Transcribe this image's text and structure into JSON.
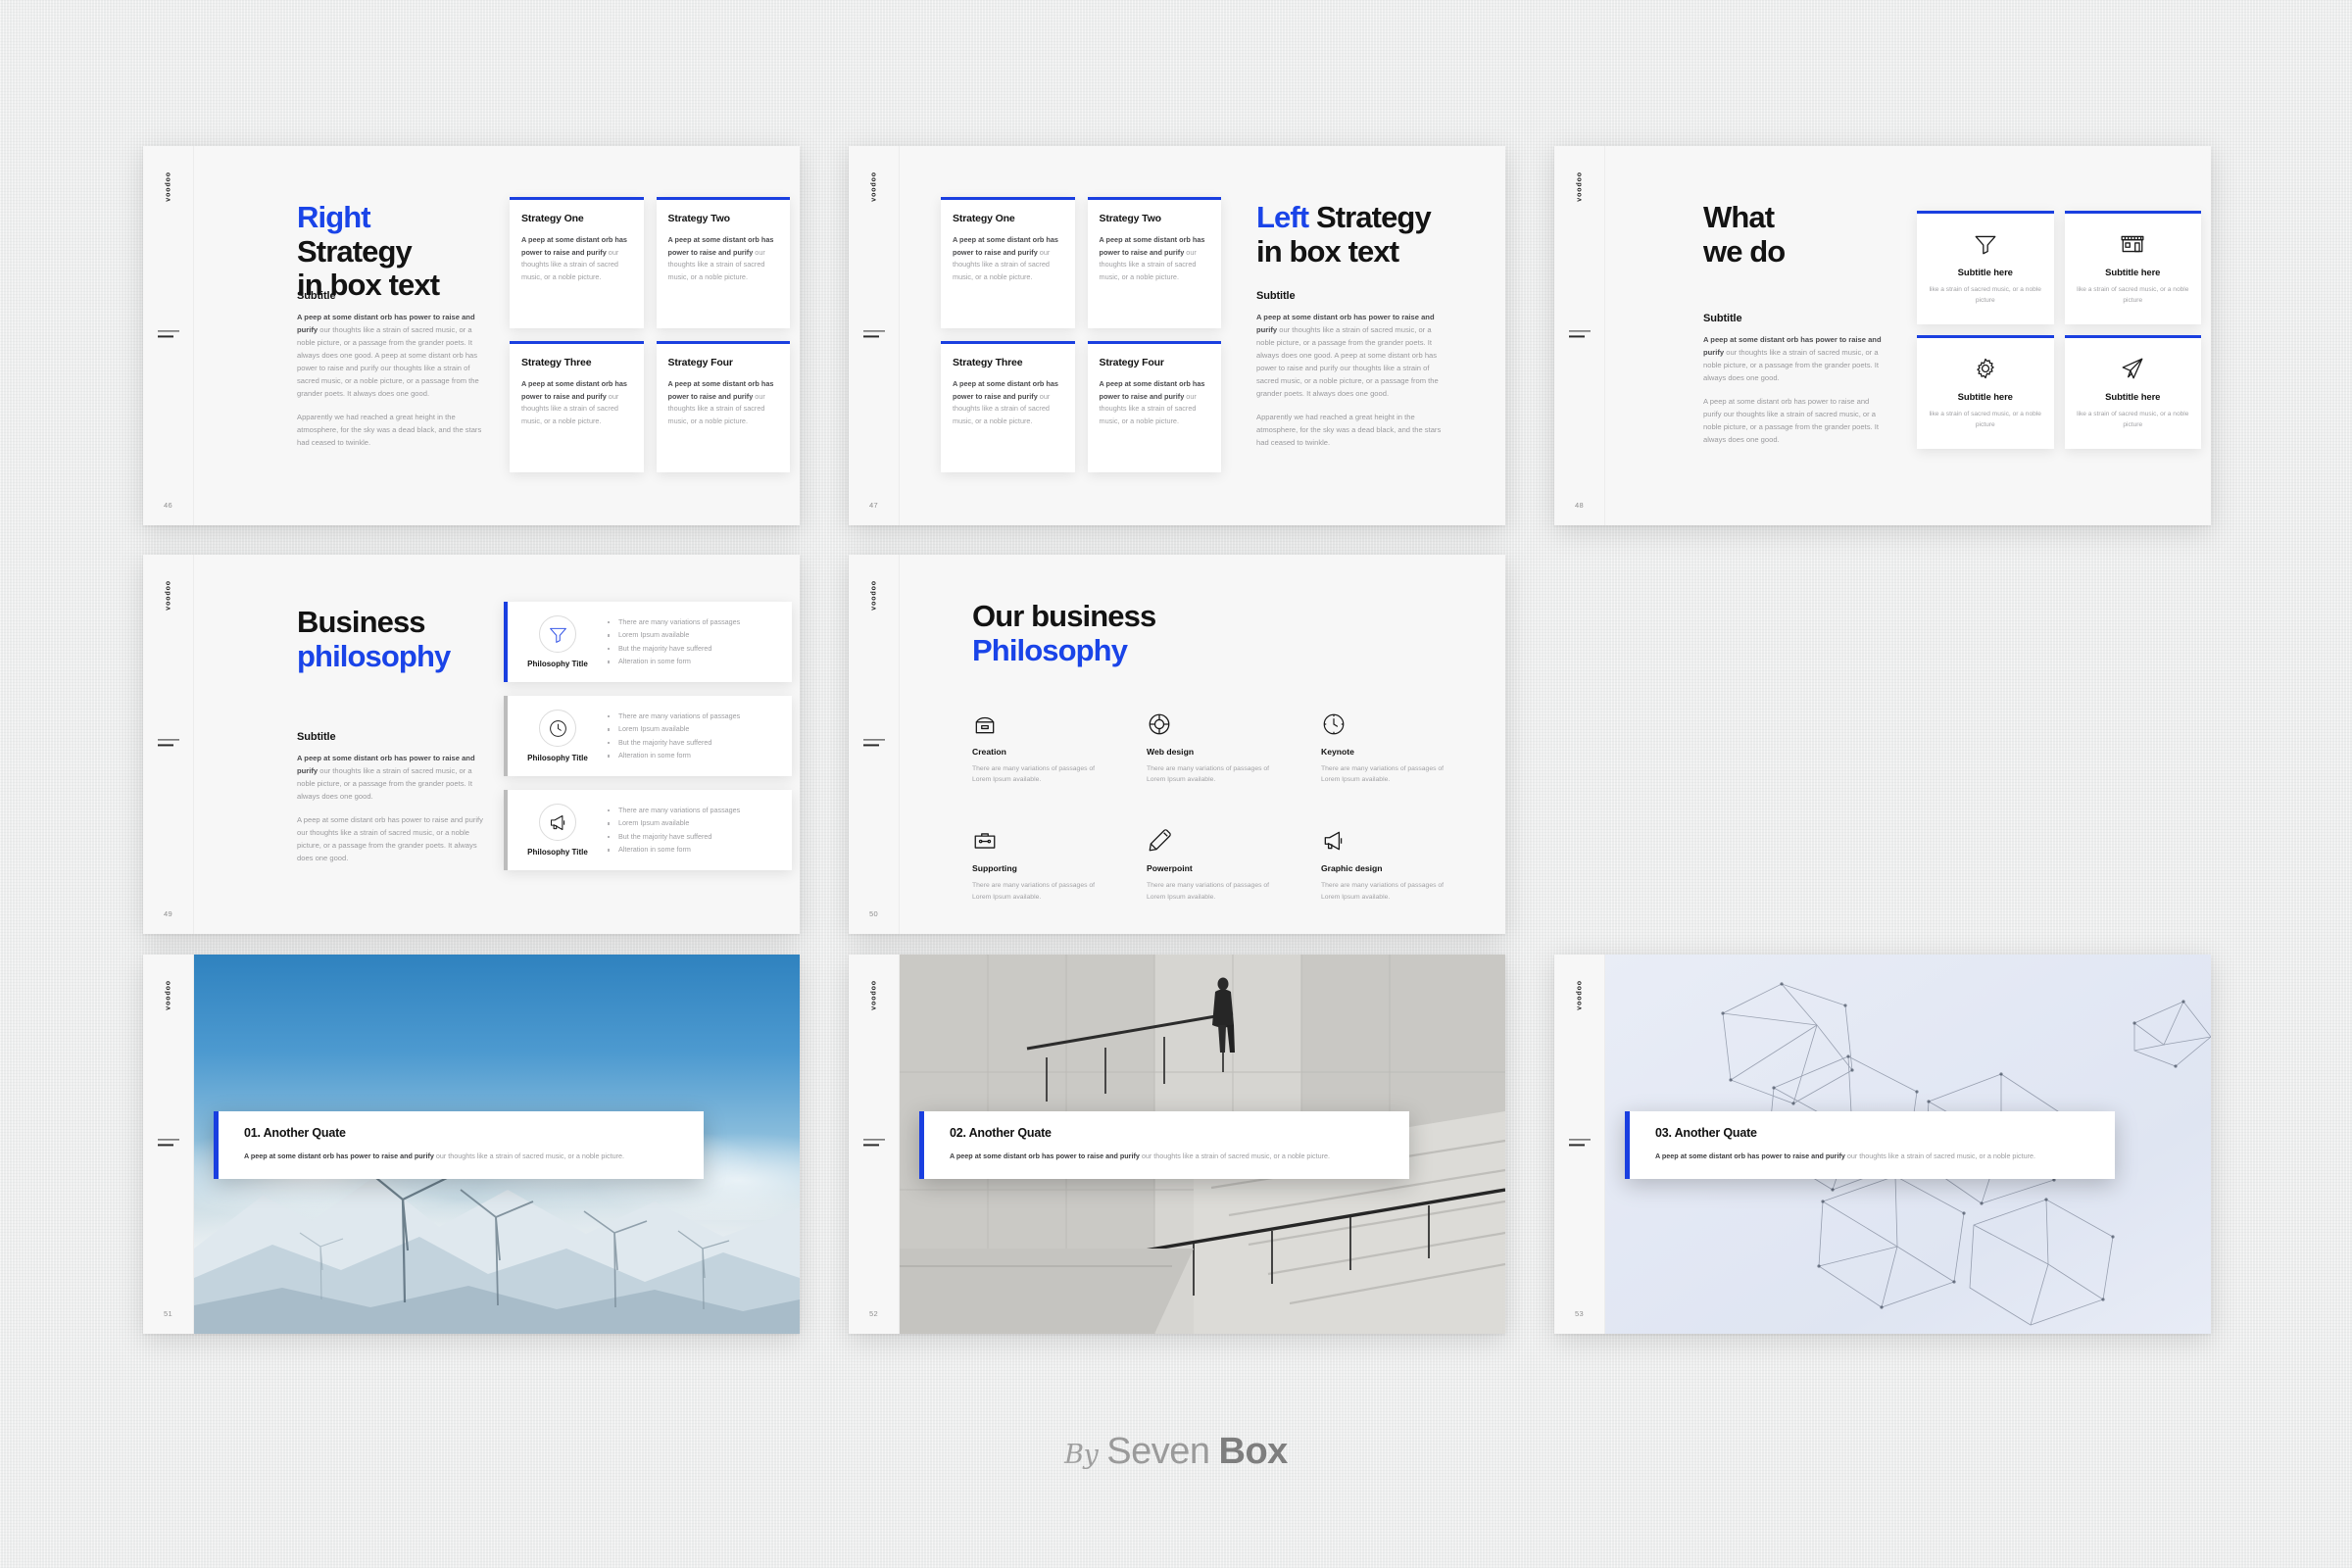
{
  "page": {
    "background_color": "#eceded",
    "accent_color": "#1a3fe0",
    "footer": {
      "by": "By",
      "brand_light": "Seven",
      "brand_bold": "Box"
    }
  },
  "shared": {
    "brand_rail_label": "voodoo",
    "subtitle_heading": "Subtitle",
    "lorem_bold": "A peep at some distant orb has power to raise and purify",
    "card_body_bold": "A peep at some distant orb has power to raise and purify",
    "card_body_rest": " our thoughts like a strain of sacred music, or a noble picture.",
    "para_long_rest": " our thoughts like a strain of sacred music, or a noble picture, or a passage from the grander poets. It always does one good. A peep at some distant orb has power to raise and purify our thoughts like a strain of sacred music, or a noble picture, or a passage from the grander poets. It always does one good.",
    "para_long_rest_short": " our thoughts like a strain of sacred music, or a noble picture, or a passage from the grander poets. It always does one good.",
    "para_second": "Apparently we had reached a great height in the atmosphere, for the sky was a dead black, and the stars had ceased to twinkle.",
    "para_plain": "A peep at some distant orb has power to raise and purify our thoughts like a strain of sacred music, or a noble picture, or a passage from the grander poets. It always does one good.",
    "icon_card_desc": "like a strain of sacred music, or a noble picture",
    "icon_card_title": "Subtitle here"
  },
  "slides": [
    {
      "page_number": "46",
      "title_accent": "Right",
      "title_rest": " Strategy",
      "title_line2": "in box text",
      "cards": [
        {
          "heading": "Strategy One"
        },
        {
          "heading": "Strategy Two"
        },
        {
          "heading": "Strategy Three"
        },
        {
          "heading": "Strategy Four"
        }
      ]
    },
    {
      "page_number": "47",
      "title_accent": "Left",
      "title_rest": " Strategy",
      "title_line2": "in box text",
      "cards": [
        {
          "heading": "Strategy One"
        },
        {
          "heading": "Strategy Two"
        },
        {
          "heading": "Strategy Three"
        },
        {
          "heading": "Strategy Four"
        }
      ]
    },
    {
      "page_number": "48",
      "title_line1": "What",
      "title_line2": "we do",
      "icon_cards": [
        {
          "icon": "funnel-icon",
          "title": "Subtitle here",
          "desc": "like a strain of sacred music, or a noble picture"
        },
        {
          "icon": "store-icon",
          "title": "Subtitle here",
          "desc": "like a strain of sacred music, or a noble picture"
        },
        {
          "icon": "gear-icon",
          "title": "Subtitle here",
          "desc": "like a strain of sacred music, or a noble picture"
        },
        {
          "icon": "paper-plane-icon",
          "title": "Subtitle here",
          "desc": "like a strain of sacred music, or a noble picture"
        }
      ]
    },
    {
      "page_number": "49",
      "title_line1": "Business",
      "title_line2_accent": "philosophy",
      "rows": [
        {
          "icon": "funnel-icon",
          "active": true,
          "title": "Philosophy Title",
          "bullets": [
            "There are many variations of passages",
            "Lorem Ipsum available",
            "But the majority have suffered",
            "Alteration in some form"
          ]
        },
        {
          "icon": "clock-icon",
          "active": false,
          "title": "Philosophy Title",
          "bullets": [
            "There are many variations of passages",
            "Lorem Ipsum available",
            "But the majority have suffered",
            "Alteration in some form"
          ]
        },
        {
          "icon": "megaphone-icon",
          "active": false,
          "title": "Philosophy Title",
          "bullets": [
            "There are many variations of passages",
            "Lorem Ipsum available",
            "But the majority have suffered",
            "Alteration in some form"
          ]
        }
      ]
    },
    {
      "page_number": "50",
      "title_line1": "Our business",
      "title_line2_accent": "Philosophy",
      "features": [
        {
          "icon": "toolbox-icon",
          "name": "Creation",
          "desc": "There are many variations of passages of Lorem Ipsum available."
        },
        {
          "icon": "lifebuoy-icon",
          "name": "Web design",
          "desc": "There are many variations of passages of Lorem Ipsum available."
        },
        {
          "icon": "clock-icon",
          "name": "Keynote",
          "desc": "There are many variations of passages of Lorem Ipsum available."
        },
        {
          "icon": "briefcase-icon",
          "name": "Supporting",
          "desc": "There are many variations of passages of Lorem Ipsum available."
        },
        {
          "icon": "pencil-icon",
          "name": "Powerpoint",
          "desc": "There are many variations of passages of Lorem Ipsum available."
        },
        {
          "icon": "megaphone-icon",
          "name": "Graphic design",
          "desc": "There are many variations of passages of Lorem Ipsum available."
        }
      ]
    },
    {
      "page_number": "51",
      "photo": "wind-turbines-mountains",
      "quote_heading": "01. Another Quate",
      "quote_bold": "A peep at some distant orb has power to raise and purify",
      "quote_rest": " our thoughts like a strain of sacred music, or a noble picture."
    },
    {
      "page_number": "52",
      "photo": "concrete-staircase-businessman",
      "quote_heading": "02. Another Quate",
      "quote_bold": "A peep at some distant orb has power to raise and purify",
      "quote_rest": " our thoughts like a strain of sacred music, or a noble picture."
    },
    {
      "page_number": "53",
      "photo": "abstract-wireframe-polygons",
      "quote_heading": "03. Another Quate",
      "quote_bold": "A peep at some distant orb has power to raise and purify",
      "quote_rest": " our thoughts like a strain of sacred music, or a noble picture."
    }
  ]
}
